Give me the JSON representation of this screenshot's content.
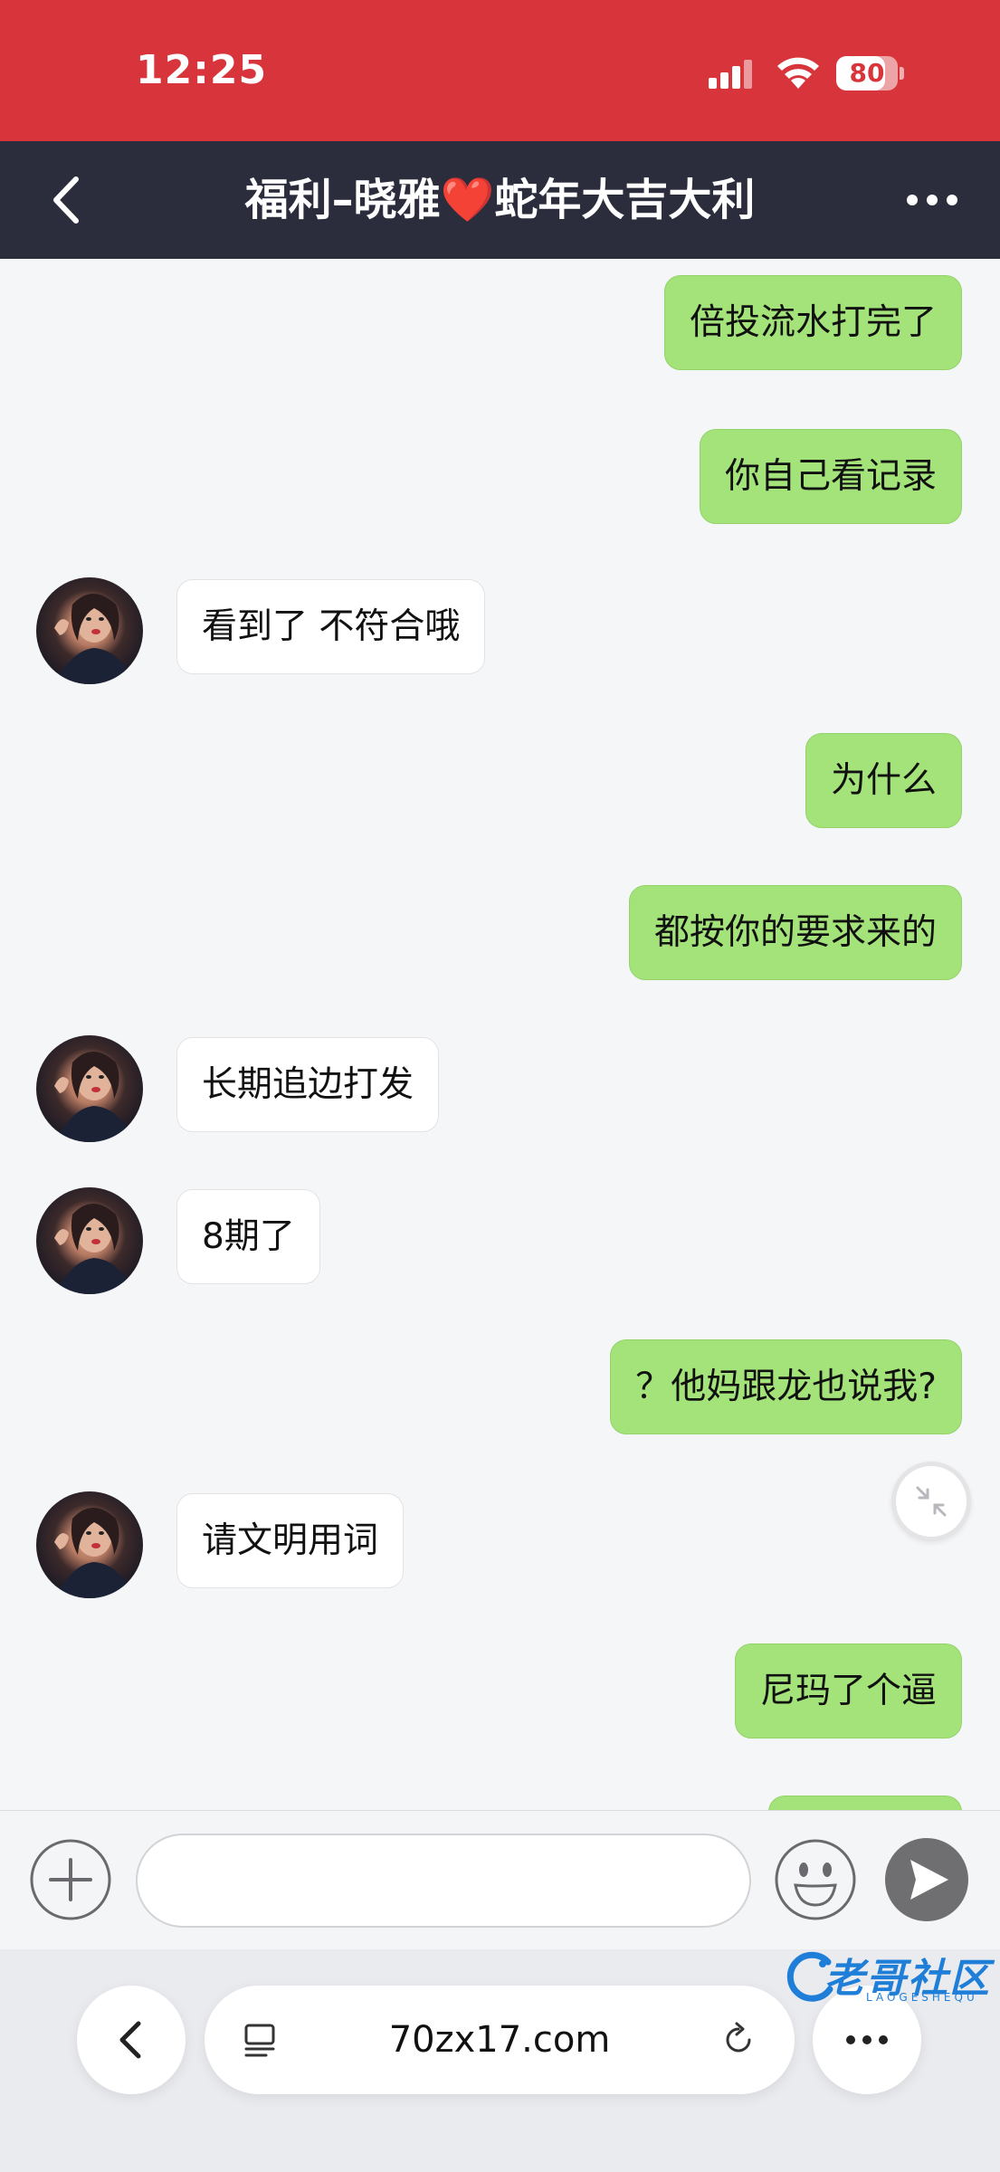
{
  "status_bar": {
    "time": "12:25",
    "battery": "80",
    "battery_level": 0.8,
    "background": "#d7353b"
  },
  "nav": {
    "title": "福利–晓雅❤️蛇年大吉大利",
    "background": "#2b2d3d"
  },
  "colors": {
    "my_bubble": "#a3e37a",
    "their_bubble": "#ffffff",
    "chat_background": "#f5f6f8"
  },
  "messages": [
    {
      "from": "me",
      "text": "倍投流水打完了"
    },
    {
      "from": "me",
      "text": "你自己看记录"
    },
    {
      "from": "them",
      "text": "看到了 不符合哦"
    },
    {
      "from": "me",
      "text": "为什么"
    },
    {
      "from": "me",
      "text": "都按你的要求来的"
    },
    {
      "from": "them",
      "text": "长期追边打发"
    },
    {
      "from": "them",
      "text": "8期了"
    },
    {
      "from": "me",
      "text": "？他妈跟龙也说我?"
    },
    {
      "from": "them",
      "text": "请文明用词"
    },
    {
      "from": "me",
      "text": "尼玛了个逼"
    },
    {
      "from": "me",
      "text": ""
    }
  ],
  "input_bar": {
    "plus_icon": "plus-circle-icon",
    "emoji_icon": "smiley-icon",
    "send_icon": "send-icon",
    "value": "",
    "placeholder": ""
  },
  "browser": {
    "url": "70zx17.com",
    "back_icon": "chevron-left-icon",
    "tabs_icon": "tabs-icon",
    "reload_icon": "reload-icon",
    "more_icon": "more-icon"
  },
  "watermark": {
    "text": "老哥社区",
    "subtext": "LAOGESHEQU"
  }
}
